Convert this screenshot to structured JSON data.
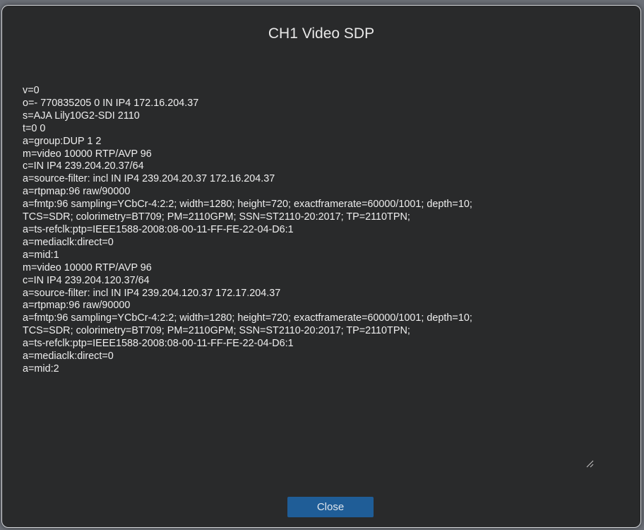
{
  "dialog": {
    "title": "CH1 Video SDP",
    "sdp_text": "v=0\no=- 770835205 0 IN IP4 172.16.204.37\ns=AJA Lily10G2-SDI 2110\nt=0 0\na=group:DUP 1 2\nm=video 10000 RTP/AVP 96\nc=IN IP4 239.204.20.37/64\na=source-filter: incl IN IP4 239.204.20.37 172.16.204.37\na=rtpmap:96 raw/90000\na=fmtp:96 sampling=YCbCr-4:2:2; width=1280; height=720; exactframerate=60000/1001; depth=10;\nTCS=SDR; colorimetry=BT709; PM=2110GPM; SSN=ST2110-20:2017; TP=2110TPN;\na=ts-refclk:ptp=IEEE1588-2008:08-00-11-FF-FE-22-04-D6:1\na=mediaclk:direct=0\na=mid:1\nm=video 10000 RTP/AVP 96\nc=IN IP4 239.204.120.37/64\na=source-filter: incl IN IP4 239.204.120.37 172.17.204.37\na=rtpmap:96 raw/90000\na=fmtp:96 sampling=YCbCr-4:2:2; width=1280; height=720; exactframerate=60000/1001; depth=10;\nTCS=SDR; colorimetry=BT709; PM=2110GPM; SSN=ST2110-20:2017; TP=2110TPN;\na=ts-refclk:ptp=IEEE1588-2008:08-00-11-FF-FE-22-04-D6:1\na=mediaclk:direct=0\na=mid:2",
    "close_label": "Close",
    "resize_icon": "resize-grip-icon"
  },
  "colors": {
    "dialog_background": "#292a2b",
    "dialog_border": "#d6d8dc",
    "text": "#eeeeee",
    "button_background": "#1f5d97",
    "button_text": "#dfe6ee"
  }
}
